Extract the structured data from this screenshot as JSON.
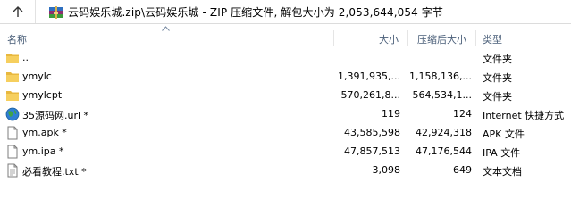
{
  "address_bar": {
    "path": "云码娱乐城.zip\\云码娱乐城 - ZIP 压缩文件, 解包大小为 2,053,644,054 字节"
  },
  "columns": {
    "name": "名称",
    "size": "大小",
    "compressed": "压缩后大小",
    "type": "类型"
  },
  "files": [
    {
      "name": "..",
      "size": "",
      "compressed": "",
      "type": "文件夹",
      "icon": "folder-icon"
    },
    {
      "name": "ymylc",
      "size": "1,391,935,...",
      "compressed": "1,158,136,...",
      "type": "文件夹",
      "icon": "folder-icon"
    },
    {
      "name": "ymylcpt",
      "size": "570,261,8...",
      "compressed": "564,534,1...",
      "type": "文件夹",
      "icon": "folder-icon"
    },
    {
      "name": "35源码网.url *",
      "size": "119",
      "compressed": "124",
      "type": "Internet 快捷方式",
      "icon": "globe-icon"
    },
    {
      "name": "ym.apk *",
      "size": "43,585,598",
      "compressed": "42,924,318",
      "type": "APK 文件",
      "icon": "file-icon"
    },
    {
      "name": "ym.ipa *",
      "size": "47,857,513",
      "compressed": "47,176,544",
      "type": "IPA 文件",
      "icon": "file-icon"
    },
    {
      "name": "必看教程.txt *",
      "size": "3,098",
      "compressed": "649",
      "type": "文本文档",
      "icon": "text-file-icon"
    }
  ]
}
